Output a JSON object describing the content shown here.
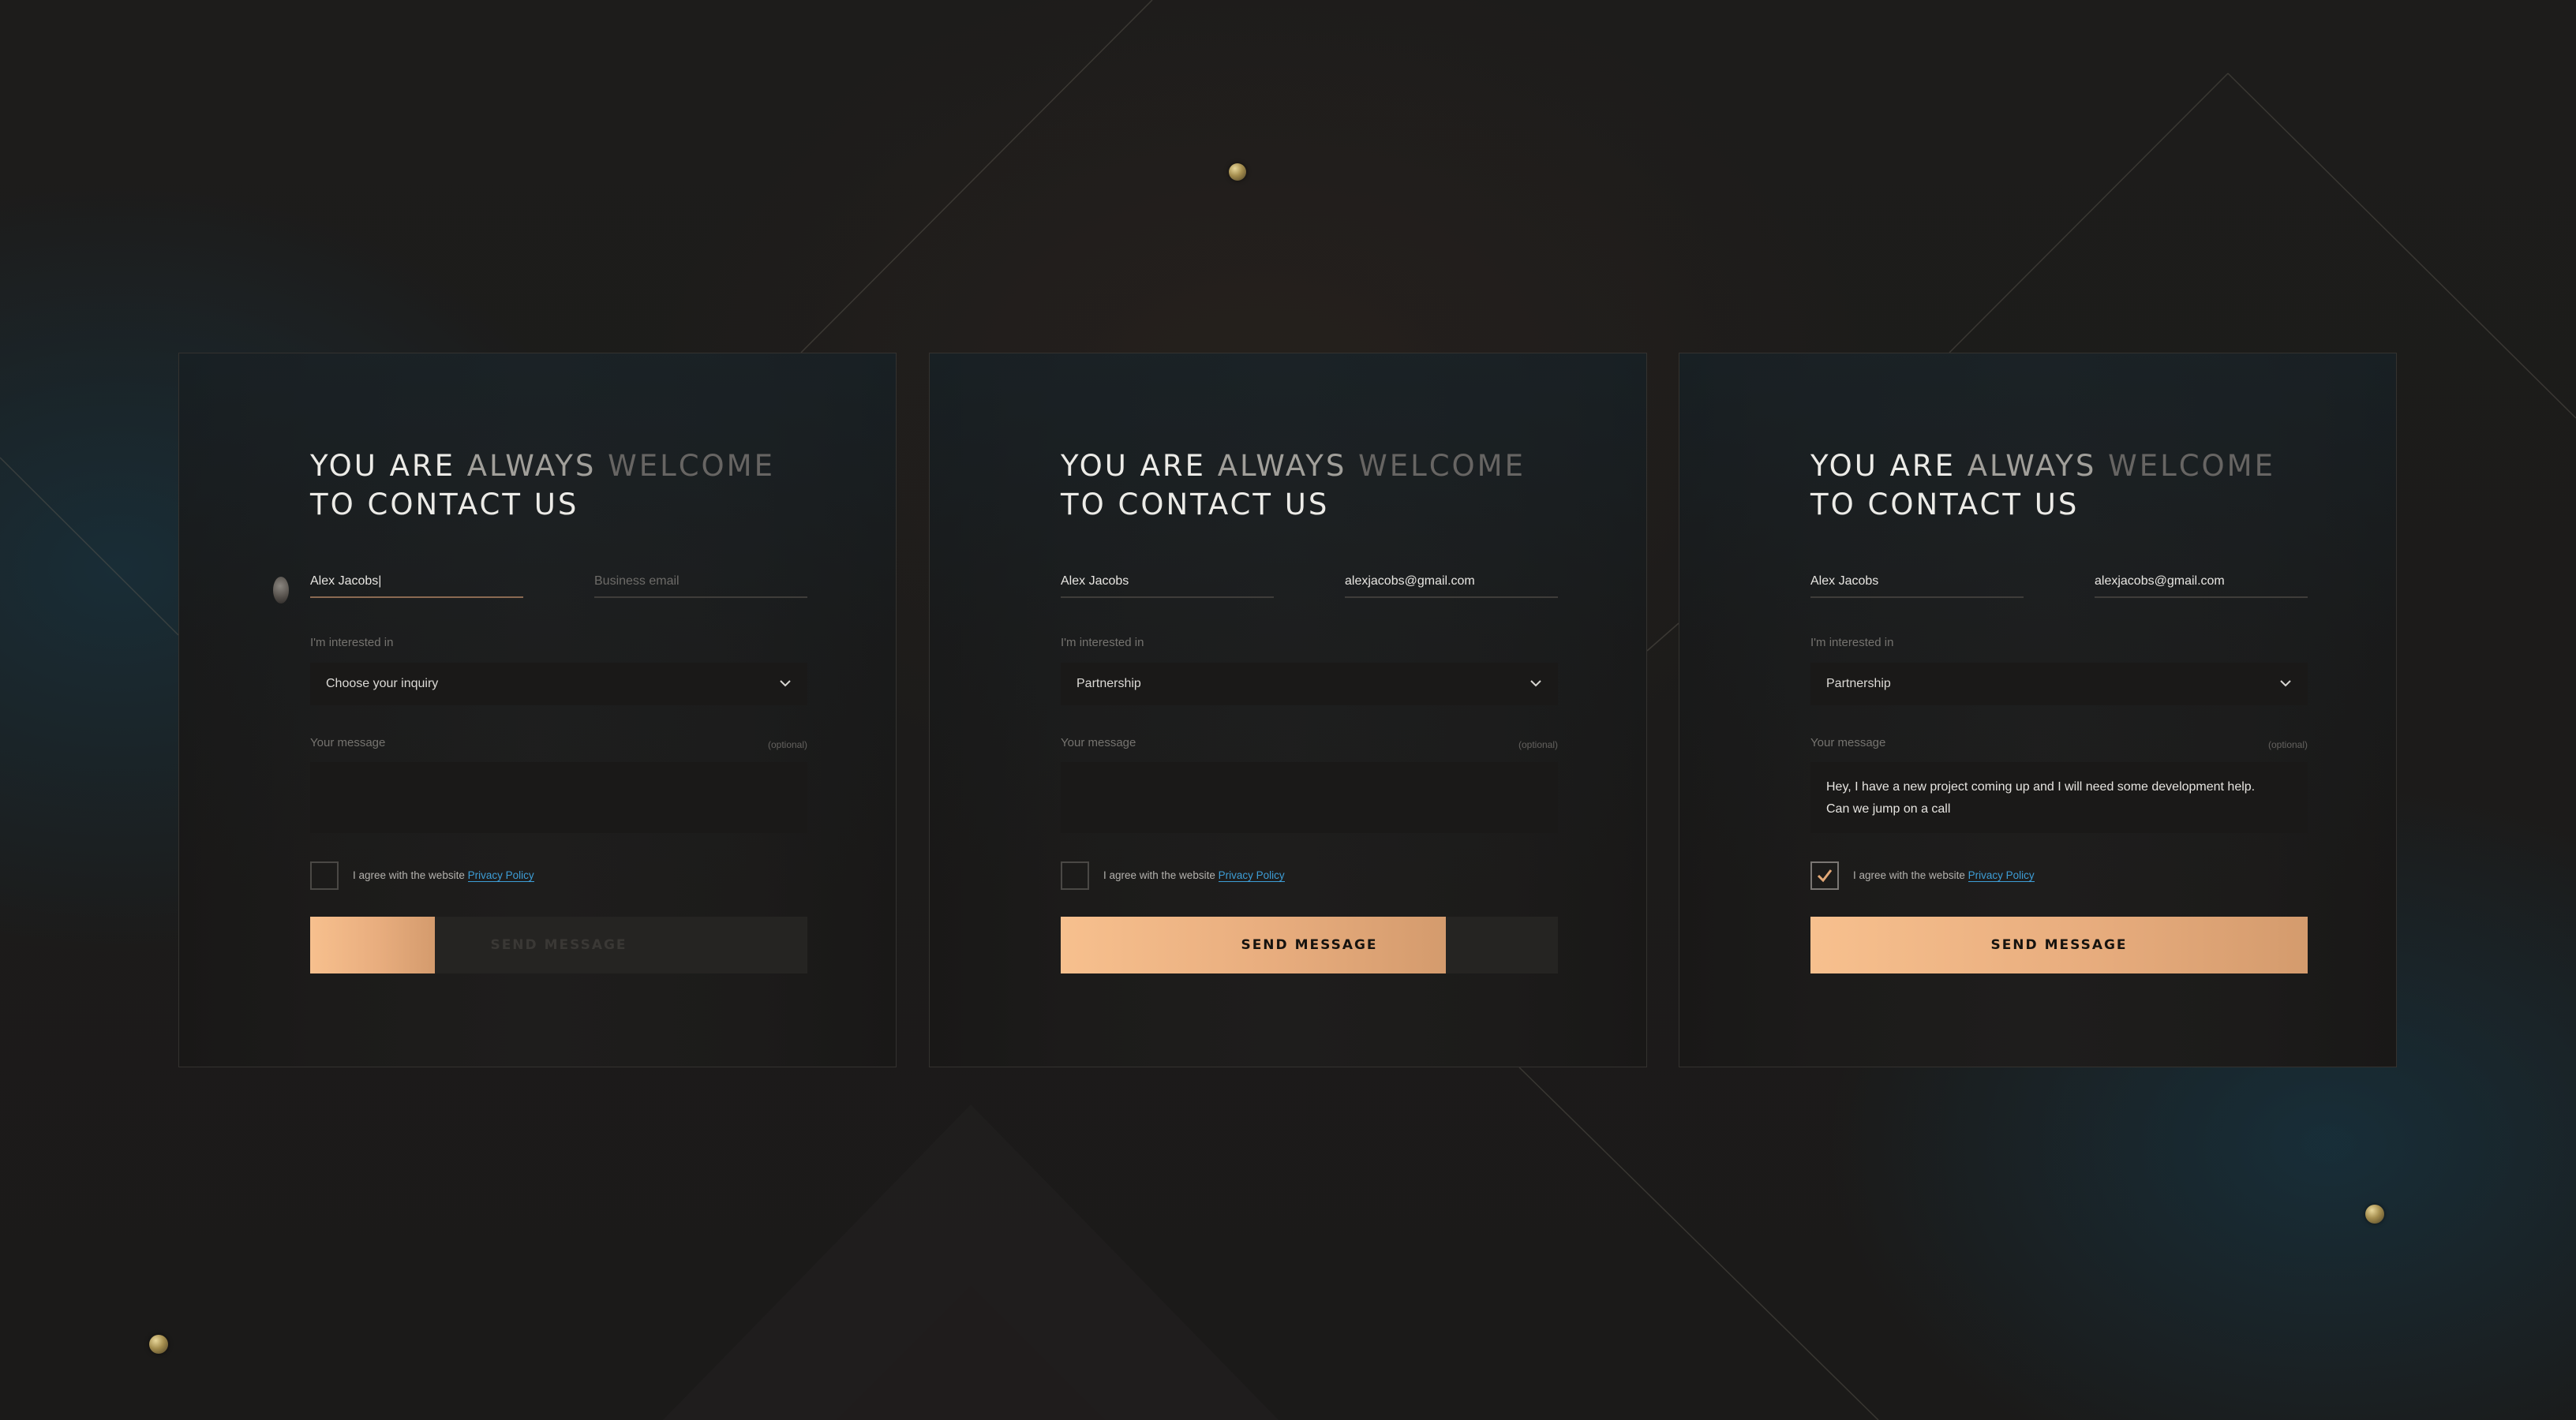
{
  "heading": {
    "line1": [
      {
        "text": "YOU",
        "tone": "bright"
      },
      {
        "text": "ARE",
        "tone": "bright"
      },
      {
        "text": "ALWAYS",
        "tone": "mid"
      },
      {
        "text": "WELCOME",
        "tone": "dim"
      }
    ],
    "line2": [
      {
        "text": "TO",
        "tone": "bright"
      },
      {
        "text": "CONTACT",
        "tone": "bright"
      },
      {
        "text": "US",
        "tone": "bright"
      }
    ]
  },
  "colors": {
    "accent_start": "#f7c08e",
    "accent_end": "#d49b6d",
    "link": "#3d9dd6",
    "background": "#1c1b1a"
  },
  "icons": {
    "select_indicator": "chevron-down-icon",
    "checkbox_mark": "check-icon",
    "cursor": "user-avatar-cursor"
  },
  "forms": [
    {
      "name_value": "Alex Jacobs|",
      "name_placeholder": "",
      "email_value": "",
      "email_placeholder": "Business email",
      "interest_label": "I'm interested in",
      "interest_value": "Choose your inquiry",
      "message_label": "Your message",
      "optional_label": "(optional)",
      "message_lines": [],
      "agree_text": "I agree with the website",
      "privacy_link": "Privacy Policy",
      "checked": false,
      "button_label": "SEND MESSAGE",
      "button_progress": 0.25,
      "button_enabled": false
    },
    {
      "name_value": "Alex Jacobs",
      "name_placeholder": "",
      "email_value": "alexjacobs@gmail.com",
      "email_placeholder": "",
      "interest_label": "I'm interested in",
      "interest_value": "Partnership",
      "message_label": "Your message",
      "optional_label": "(optional)",
      "message_lines": [],
      "agree_text": "I agree with the website",
      "privacy_link": "Privacy Policy",
      "checked": false,
      "button_label": "SEND MESSAGE",
      "button_progress": 0.775,
      "button_enabled": true
    },
    {
      "name_value": "Alex Jacobs",
      "name_placeholder": "",
      "email_value": "alexjacobs@gmail.com",
      "email_placeholder": "",
      "interest_label": "I'm interested in",
      "interest_value": "Partnership",
      "message_label": "Your message",
      "optional_label": "(optional)",
      "message_lines": [
        "Hey, I have a new project coming up and I will need some development help.",
        "Can we jump on a call"
      ],
      "agree_text": "I agree with the website",
      "privacy_link": "Privacy Policy",
      "checked": true,
      "button_label": "SEND MESSAGE",
      "button_progress": 1.0,
      "button_enabled": true
    }
  ]
}
